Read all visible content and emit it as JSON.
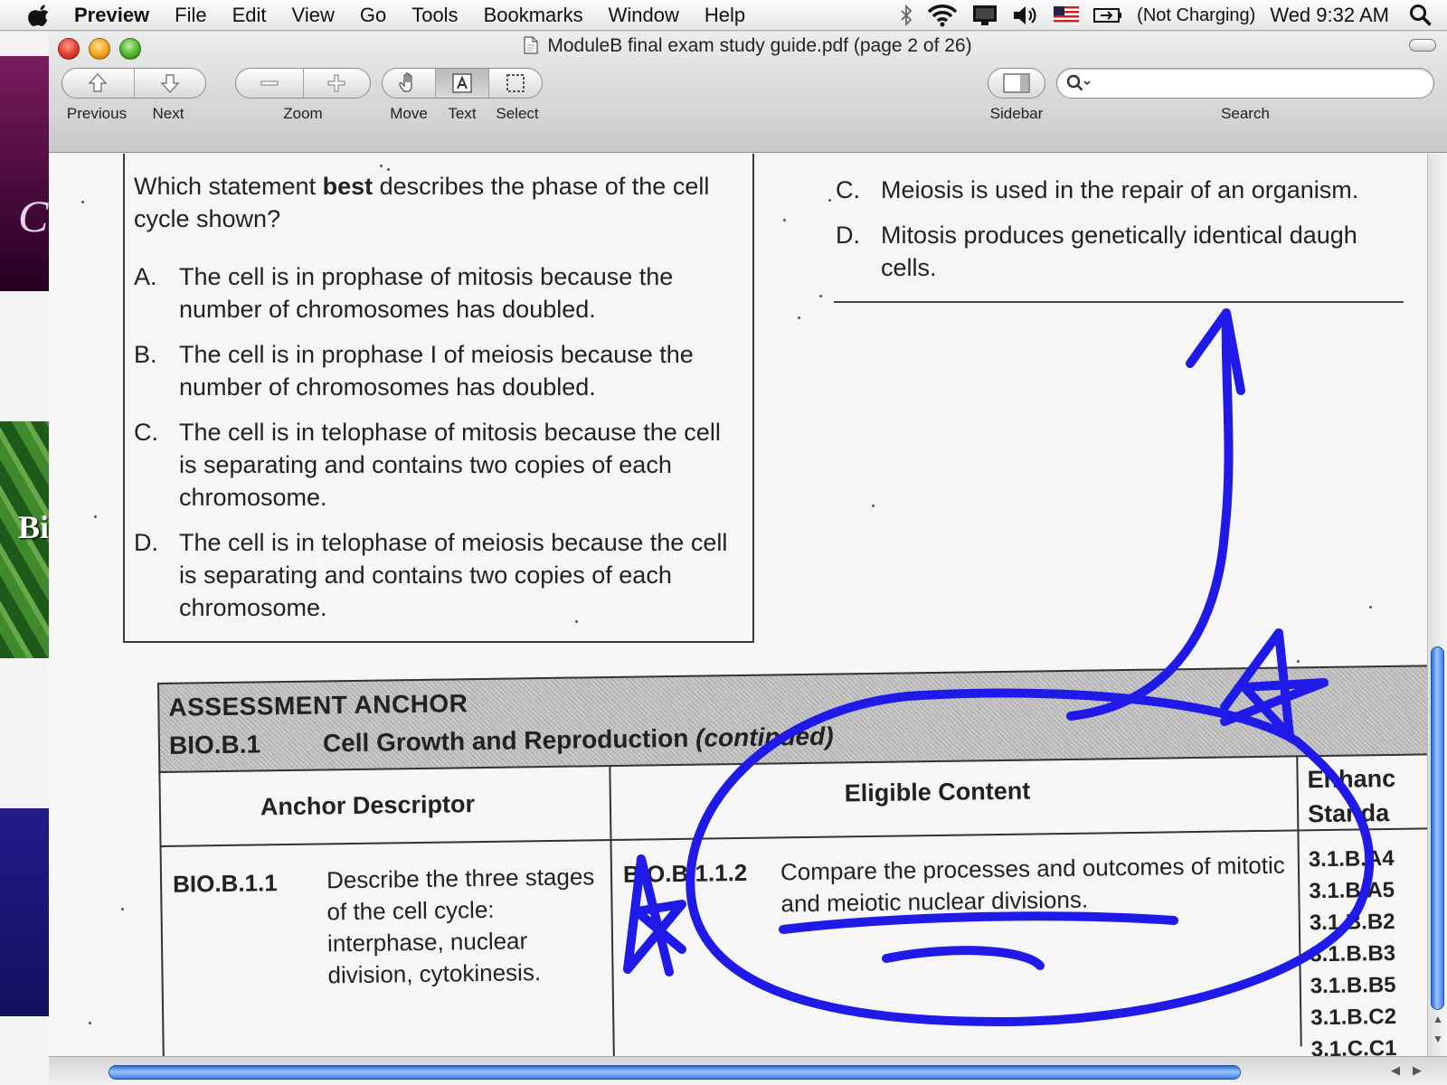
{
  "menubar": {
    "app_name": "Preview",
    "menus": [
      "File",
      "Edit",
      "View",
      "Go",
      "Tools",
      "Bookmarks",
      "Window",
      "Help"
    ],
    "battery_status": "(Not Charging)",
    "clock": "Wed 9:32 AM"
  },
  "window": {
    "title": "ModuleB final exam study guide.pdf (page 2 of 26)"
  },
  "toolbar": {
    "previous_label": "Previous",
    "next_label": "Next",
    "zoom_label": "Zoom",
    "move_label": "Move",
    "text_label": "Text",
    "select_label": "Select",
    "sidebar_label": "Sidebar",
    "search_label": "Search",
    "search_value": ""
  },
  "desktop": {
    "purple_letter": "C",
    "green_letters": "Bi"
  },
  "question": {
    "stem_pre": "Which statement ",
    "stem_bold": "best",
    "stem_post": " describes the phase of the cell cycle shown?",
    "options": [
      {
        "letter": "A.",
        "text": "The cell is in prophase of mitosis because the number of chromosomes has doubled."
      },
      {
        "letter": "B.",
        "text": "The cell is in prophase I of meiosis because the number of chromosomes has doubled."
      },
      {
        "letter": "C.",
        "text": "The cell is in telophase of mitosis because the cell is separating and contains two copies of each chromosome."
      },
      {
        "letter": "D.",
        "text": "The cell is in telophase of meiosis because the cell is separating and contains two copies of each chromosome."
      }
    ]
  },
  "right_options": [
    {
      "letter": "C.",
      "text": "Meiosis is used in the repair of an organism."
    },
    {
      "letter": "D.",
      "text": "Mitosis produces genetically identical daugh cells."
    }
  ],
  "anchor": {
    "title": "ASSESSMENT ANCHOR",
    "code": "BIO.B.1",
    "name": "Cell Growth and Reproduction",
    "name_suffix": "(continued)",
    "col_descriptor": "Anchor Descriptor",
    "col_eligible": "Eligible Content",
    "col_standards_1": "Enhanc",
    "col_standards_2": "Standa",
    "row_code": "BIO.B.1.1",
    "row_descriptor": "Describe the three stages of the cell cycle: interphase, nuclear division, cytokinesis.",
    "eligible_code": "BIO.B.1.1.2",
    "eligible_text": "Compare the processes and outcomes of mitotic and meiotic nuclear divisions.",
    "standards": [
      "3.1.B.A4",
      "3.1.B.A5",
      "3.1.B.B2",
      "3.1.B.B3",
      "3.1.B.B5",
      "3.1.B.C2",
      "3.1.C.C1"
    ]
  },
  "colors": {
    "ink": "#1f1ae8",
    "scrollbar": "#3d7de3"
  }
}
